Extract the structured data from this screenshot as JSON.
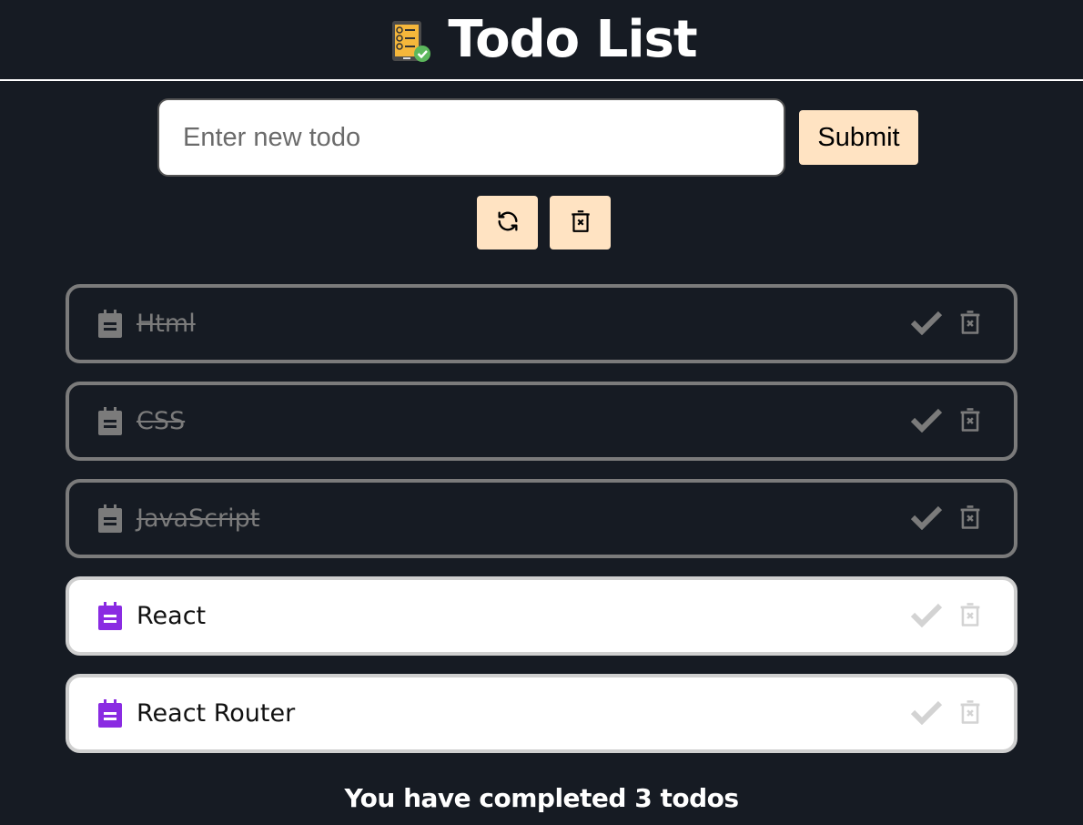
{
  "header": {
    "title": "Todo List",
    "logo_icon": "checklist-tablet-icon"
  },
  "form": {
    "input_placeholder": "Enter new todo",
    "input_value": "",
    "submit_label": "Submit"
  },
  "toolbar": {
    "refresh_icon": "refresh-icon",
    "clear_icon": "trash-x-icon"
  },
  "todos": [
    {
      "text": "Html",
      "completed": true
    },
    {
      "text": "CSS",
      "completed": true
    },
    {
      "text": "JavaScript",
      "completed": true
    },
    {
      "text": "React",
      "completed": false
    },
    {
      "text": "React Router",
      "completed": false
    }
  ],
  "footer": {
    "completed_text": "You have completed 3 todos"
  },
  "colors": {
    "background": "#161b23",
    "button_bg": "#ffe3c2",
    "active_icon": "#8a2be2",
    "completed_gray": "#7b7b7b"
  }
}
